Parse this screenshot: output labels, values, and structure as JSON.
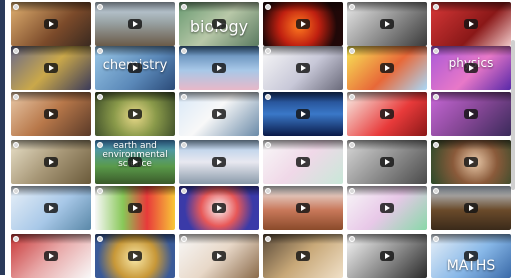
{
  "tiles": [
    {
      "name": "video-tile-1-1",
      "bg": "linear-gradient(135deg,#e0b070,#7b4a2a 60%,#3a2a20)",
      "title": "",
      "big": ""
    },
    {
      "name": "video-tile-1-2",
      "bg": "linear-gradient(180deg,#c8d8e8,#9aa4a6 45%,#6a5a48)",
      "title": "",
      "big": ""
    },
    {
      "name": "video-tile-1-3",
      "bg": "linear-gradient(135deg,#6a9a72,#b8c8a8 50%,#5a7a60)",
      "title": "",
      "big": "biology"
    },
    {
      "name": "video-tile-1-4",
      "bg": "radial-gradient(circle at 45% 55%,#ff7a20,#c02010 40%,#200808 75%)",
      "title": "",
      "big": ""
    },
    {
      "name": "video-tile-1-5",
      "bg": "linear-gradient(135deg,#e8e8e8,#8a8a8a 55%,#3a3a3a)",
      "title": "",
      "big": ""
    },
    {
      "name": "video-tile-1-6",
      "bg": "linear-gradient(135deg,#d83838,#8a1818 60%,#f0c8c8)",
      "title": "",
      "big": ""
    },
    {
      "name": "video-tile-2-1",
      "bg": "linear-gradient(135deg,#6a6a8a,#caa84a 50%,#3a3a5a)",
      "title": "",
      "big": ""
    },
    {
      "name": "video-tile-2-2",
      "bg": "linear-gradient(135deg,#9ac8e8,#5a88b8 60%,#2a4a78)",
      "title": "",
      "big": "chemistry"
    },
    {
      "name": "video-tile-2-3",
      "bg": "linear-gradient(180deg,#4a78a8,#a8c8e8 55%,#e8b8c8)",
      "title": "",
      "big": ""
    },
    {
      "name": "video-tile-2-4",
      "bg": "linear-gradient(135deg,#f8f8f8,#c8c8d8 55%,#6a6a7a)",
      "title": "",
      "big": ""
    },
    {
      "name": "video-tile-2-5",
      "bg": "linear-gradient(135deg,#f8e858,#e86838 55%,#a8d8f8)",
      "title": "",
      "big": ""
    },
    {
      "name": "video-tile-2-6",
      "bg": "linear-gradient(135deg,#a858d8,#e878c8 55%,#5828a8)",
      "title": "",
      "big": "physics"
    },
    {
      "name": "video-tile-3-1",
      "bg": "linear-gradient(135deg,#e8c8a8,#b8784a 50%,#5a3a28)",
      "title": "",
      "big": ""
    },
    {
      "name": "video-tile-3-2",
      "bg": "radial-gradient(circle at 50% 55%,#e8d888,#8a9a4a 45%,#3a4a28)",
      "title": "",
      "big": ""
    },
    {
      "name": "video-tile-3-3",
      "bg": "linear-gradient(135deg,#d8e8f8,#f8f8f8 45%,#6a8aa8)",
      "title": "",
      "big": ""
    },
    {
      "name": "video-tile-3-4",
      "bg": "linear-gradient(180deg,#1a3a78,#3a78c8 50%,#0a1a48)",
      "title": "",
      "big": ""
    },
    {
      "name": "video-tile-3-5",
      "bg": "linear-gradient(135deg,#f8f0e8,#e83a3a 60%,#8a1818)",
      "title": "",
      "big": ""
    },
    {
      "name": "video-tile-3-6",
      "bg": "linear-gradient(135deg,#c868d8,#884898 50%,#3a2a5a)",
      "title": "",
      "big": ""
    },
    {
      "name": "video-tile-4-1",
      "bg": "linear-gradient(135deg,#e8e0c8,#a89878 50%,#6a5a3a)",
      "title": "",
      "big": ""
    },
    {
      "name": "video-tile-4-2",
      "bg": "linear-gradient(180deg,#4a98d8,#5a9a4a 60%,#3a5a2a)",
      "title": "",
      "big": "earth and environmental science"
    },
    {
      "name": "video-tile-4-3",
      "bg": "linear-gradient(180deg,#a8c8e8,#e8e8f0 50%,#8a9aaa)",
      "title": "",
      "big": ""
    },
    {
      "name": "video-tile-4-4",
      "bg": "linear-gradient(135deg,#f8f8f8,#f0d8e8 50%,#c8e8d8)",
      "title": "",
      "big": ""
    },
    {
      "name": "video-tile-4-5",
      "bg": "linear-gradient(135deg,#d8d8d8,#8a8a8a 55%,#4a4a4a)",
      "title": "",
      "big": ""
    },
    {
      "name": "video-tile-4-6",
      "bg": "radial-gradient(circle at 55% 50%,#e8c8a8,#8a5a3a 45%,#2a4a2a)",
      "title": "",
      "big": ""
    },
    {
      "name": "video-tile-5-1",
      "bg": "linear-gradient(135deg,#e8f0f8,#a8c8e8 55%,#5a88a8)",
      "title": "",
      "big": ""
    },
    {
      "name": "video-tile-5-2",
      "bg": "linear-gradient(90deg,#f8f8f8,#88c858 35%,#e83a3a 65%,#f8c838)",
      "title": "",
      "big": ""
    },
    {
      "name": "video-tile-5-3",
      "bg": "radial-gradient(circle at 50% 50%,#f8f8f8,#e85858 40%,#3a3aa8 75%)",
      "title": "",
      "big": ""
    },
    {
      "name": "video-tile-5-4",
      "bg": "linear-gradient(180deg,#f0f0f0,#c8785a 55%,#8a4a2a)",
      "title": "",
      "big": ""
    },
    {
      "name": "video-tile-5-5",
      "bg": "linear-gradient(135deg,#f8f8f8,#e8c8e8 50%,#88d8a8)",
      "title": "",
      "big": ""
    },
    {
      "name": "video-tile-5-6",
      "bg": "linear-gradient(180deg,#c8d8e8,#6a4a2a 55%,#3a2a1a)",
      "title": "",
      "big": ""
    },
    {
      "name": "video-tile-6-1",
      "bg": "linear-gradient(135deg,#c83838,#e8a8a8 50%,#f8f8f8)",
      "title": "",
      "big": ""
    },
    {
      "name": "video-tile-6-2",
      "bg": "radial-gradient(circle at 50% 55%,#f8e8a8,#c89838 45%,#3a5a98 80%)",
      "title": "",
      "big": ""
    },
    {
      "name": "video-tile-6-3",
      "bg": "linear-gradient(135deg,#f8f8f8,#e8d8c8 50%,#8a6a4a)",
      "title": "",
      "big": ""
    },
    {
      "name": "video-tile-6-4",
      "bg": "linear-gradient(135deg,#5a4a3a,#c8a878 50%,#f0e0c8)",
      "title": "",
      "big": ""
    },
    {
      "name": "video-tile-6-5",
      "bg": "linear-gradient(135deg,#f8f8f8,#8a8a8a 55%,#2a2a2a)",
      "title": "",
      "big": ""
    },
    {
      "name": "video-tile-6-6",
      "bg": "linear-gradient(135deg,#e8f0f8,#88b8e8 55%,#3a6aa8)",
      "title": "",
      "big": "MATHS"
    }
  ]
}
